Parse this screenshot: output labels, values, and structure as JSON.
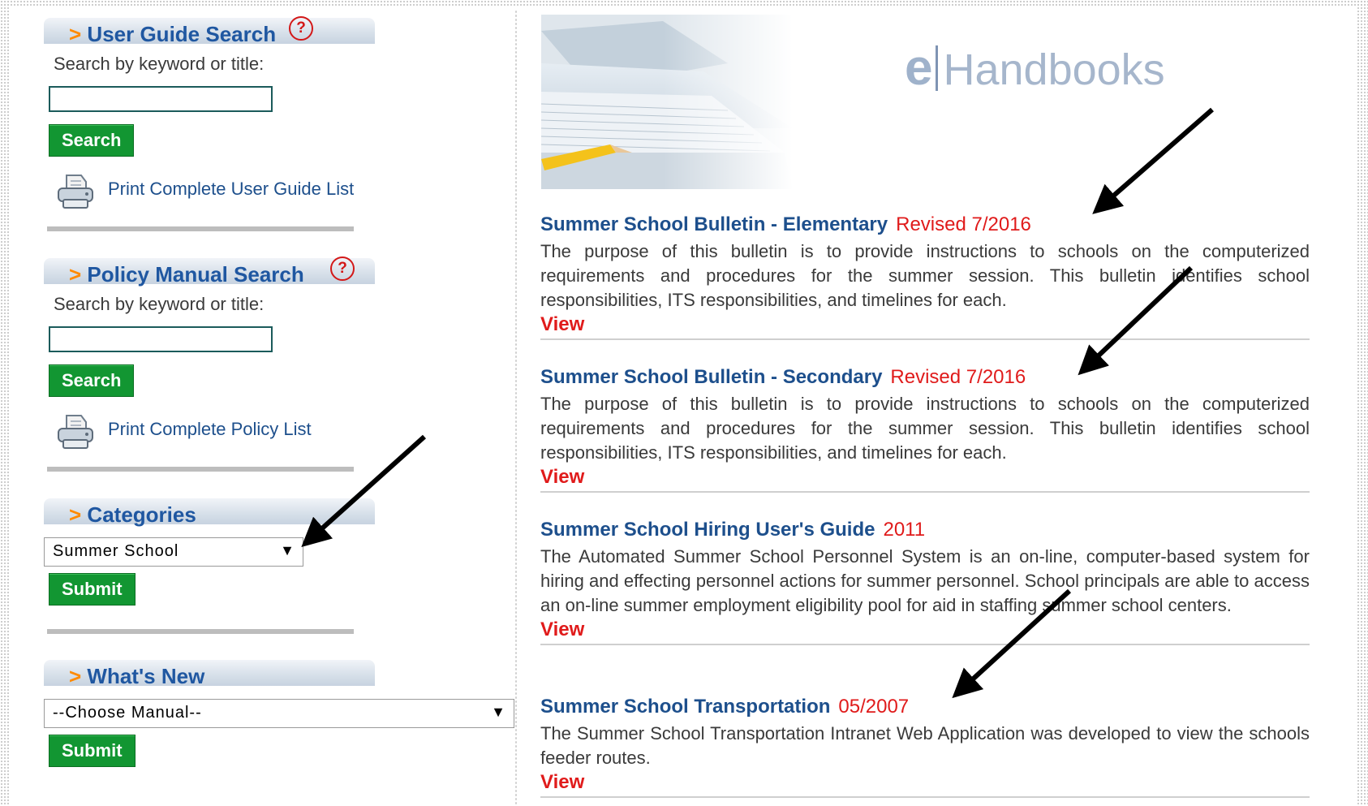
{
  "sidebar": {
    "user_guide": {
      "arrow": ">",
      "title": "User Guide Search",
      "help_symbol": "?",
      "search_label": "Search by keyword or title:",
      "search_value": "",
      "search_button": "Search",
      "print_link": "Print Complete User Guide List"
    },
    "policy": {
      "arrow": ">",
      "title": "Policy Manual Search",
      "help_symbol": "?",
      "search_label": "Search by keyword or title:",
      "search_value": "",
      "search_button": "Search",
      "print_link": "Print Complete Policy List"
    },
    "categories": {
      "arrow": ">",
      "title": "Categories",
      "selected": "Summer School",
      "caret": "▼",
      "submit": "Submit"
    },
    "whats_new": {
      "arrow": ">",
      "title": "What's New",
      "selected": "--Choose Manual--",
      "caret": "▼",
      "submit": "Submit"
    }
  },
  "main": {
    "logo": {
      "e": "e",
      "word": "Handbooks"
    },
    "entries": [
      {
        "title": "Summer School Bulletin - Elementary",
        "revised": "Revised 7/2016",
        "description": "The purpose of this bulletin is to provide instructions to schools on the computerized requirements and procedures for the summer session. This bulletin identifies school responsibilities, ITS responsibilities, and timelines for each.",
        "view": "View"
      },
      {
        "title": "Summer School Bulletin - Secondary",
        "revised": "Revised 7/2016",
        "description": "The purpose of this bulletin is to provide instructions to schools on the computerized requirements and procedures for the summer session. This bulletin identifies school responsibilities, ITS responsibilities, and timelines for each.",
        "view": "View"
      },
      {
        "title": "Summer School Hiring User's Guide",
        "revised": "2011",
        "description": "The Automated Summer School Personnel System is an on-line, computer-based system for hiring and effecting personnel actions for summer personnel. School principals are able to access an on-line summer employment eligibility pool for aid in staffing summer school centers.",
        "view": "View"
      },
      {
        "title": "Summer School Transportation",
        "revised": "05/2007",
        "description": "The Summer School Transportation Intranet Web Application was developed to view the schools feeder routes.",
        "view": "View"
      }
    ]
  },
  "colors": {
    "link_blue": "#1d4f8c",
    "header_blue": "#1f57a1",
    "accent_orange": "#ff8a00",
    "alert_red": "#e01b1b",
    "button_green": "#129632"
  },
  "icons": [
    "help-icon",
    "printer-icon",
    "chevron-down-icon"
  ]
}
